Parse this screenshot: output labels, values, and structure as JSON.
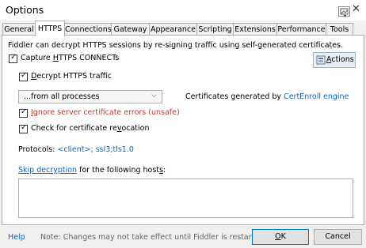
{
  "window": {
    "title": "Options"
  },
  "tabs": [
    {
      "label": "General"
    },
    {
      "label": "HTTPS"
    },
    {
      "label": "Connections"
    },
    {
      "label": "Gateway"
    },
    {
      "label": "Appearance"
    },
    {
      "label": "Scripting"
    },
    {
      "label": "Extensions"
    },
    {
      "label": "Performance"
    },
    {
      "label": "Tools"
    }
  ],
  "https": {
    "intro": "Fiddler can decrypt HTTPS sessions by re-signing traffic using self-generated certificates.",
    "capture_pre": "Capture ",
    "capture_u": "H",
    "capture_post": "TTPS CONNECTs",
    "decrypt_u": "D",
    "decrypt_post": "ecrypt HTTPS traffic",
    "process_filter": "...from all processes",
    "cert_text": "Certificates generated by ",
    "cert_link": "CertEnroll engine",
    "ignore_u": "I",
    "ignore_post": "gnore server certificate errors (unsafe)",
    "revoke_pre": "Check for certificate re",
    "revoke_u": "v",
    "revoke_post": "ocation",
    "protocols_label": "Protocols: ",
    "protocols_value": "<client>; ssl3;tls1.0",
    "skip_link": "Skip decryption",
    "skip_rest_pre": " for the following host",
    "skip_rest_u": "s",
    "skip_rest_post": ":",
    "actions_u": "A",
    "actions_post": "ctions",
    "hosts_value": ""
  },
  "footer": {
    "help": "Help",
    "note": "Note: Changes may not take effect until Fiddler is restarted.",
    "ok_u": "O",
    "ok_post": "K",
    "cancel": "Cancel"
  },
  "colors": {
    "link": "#0066cc",
    "warning": "#c0392b"
  }
}
